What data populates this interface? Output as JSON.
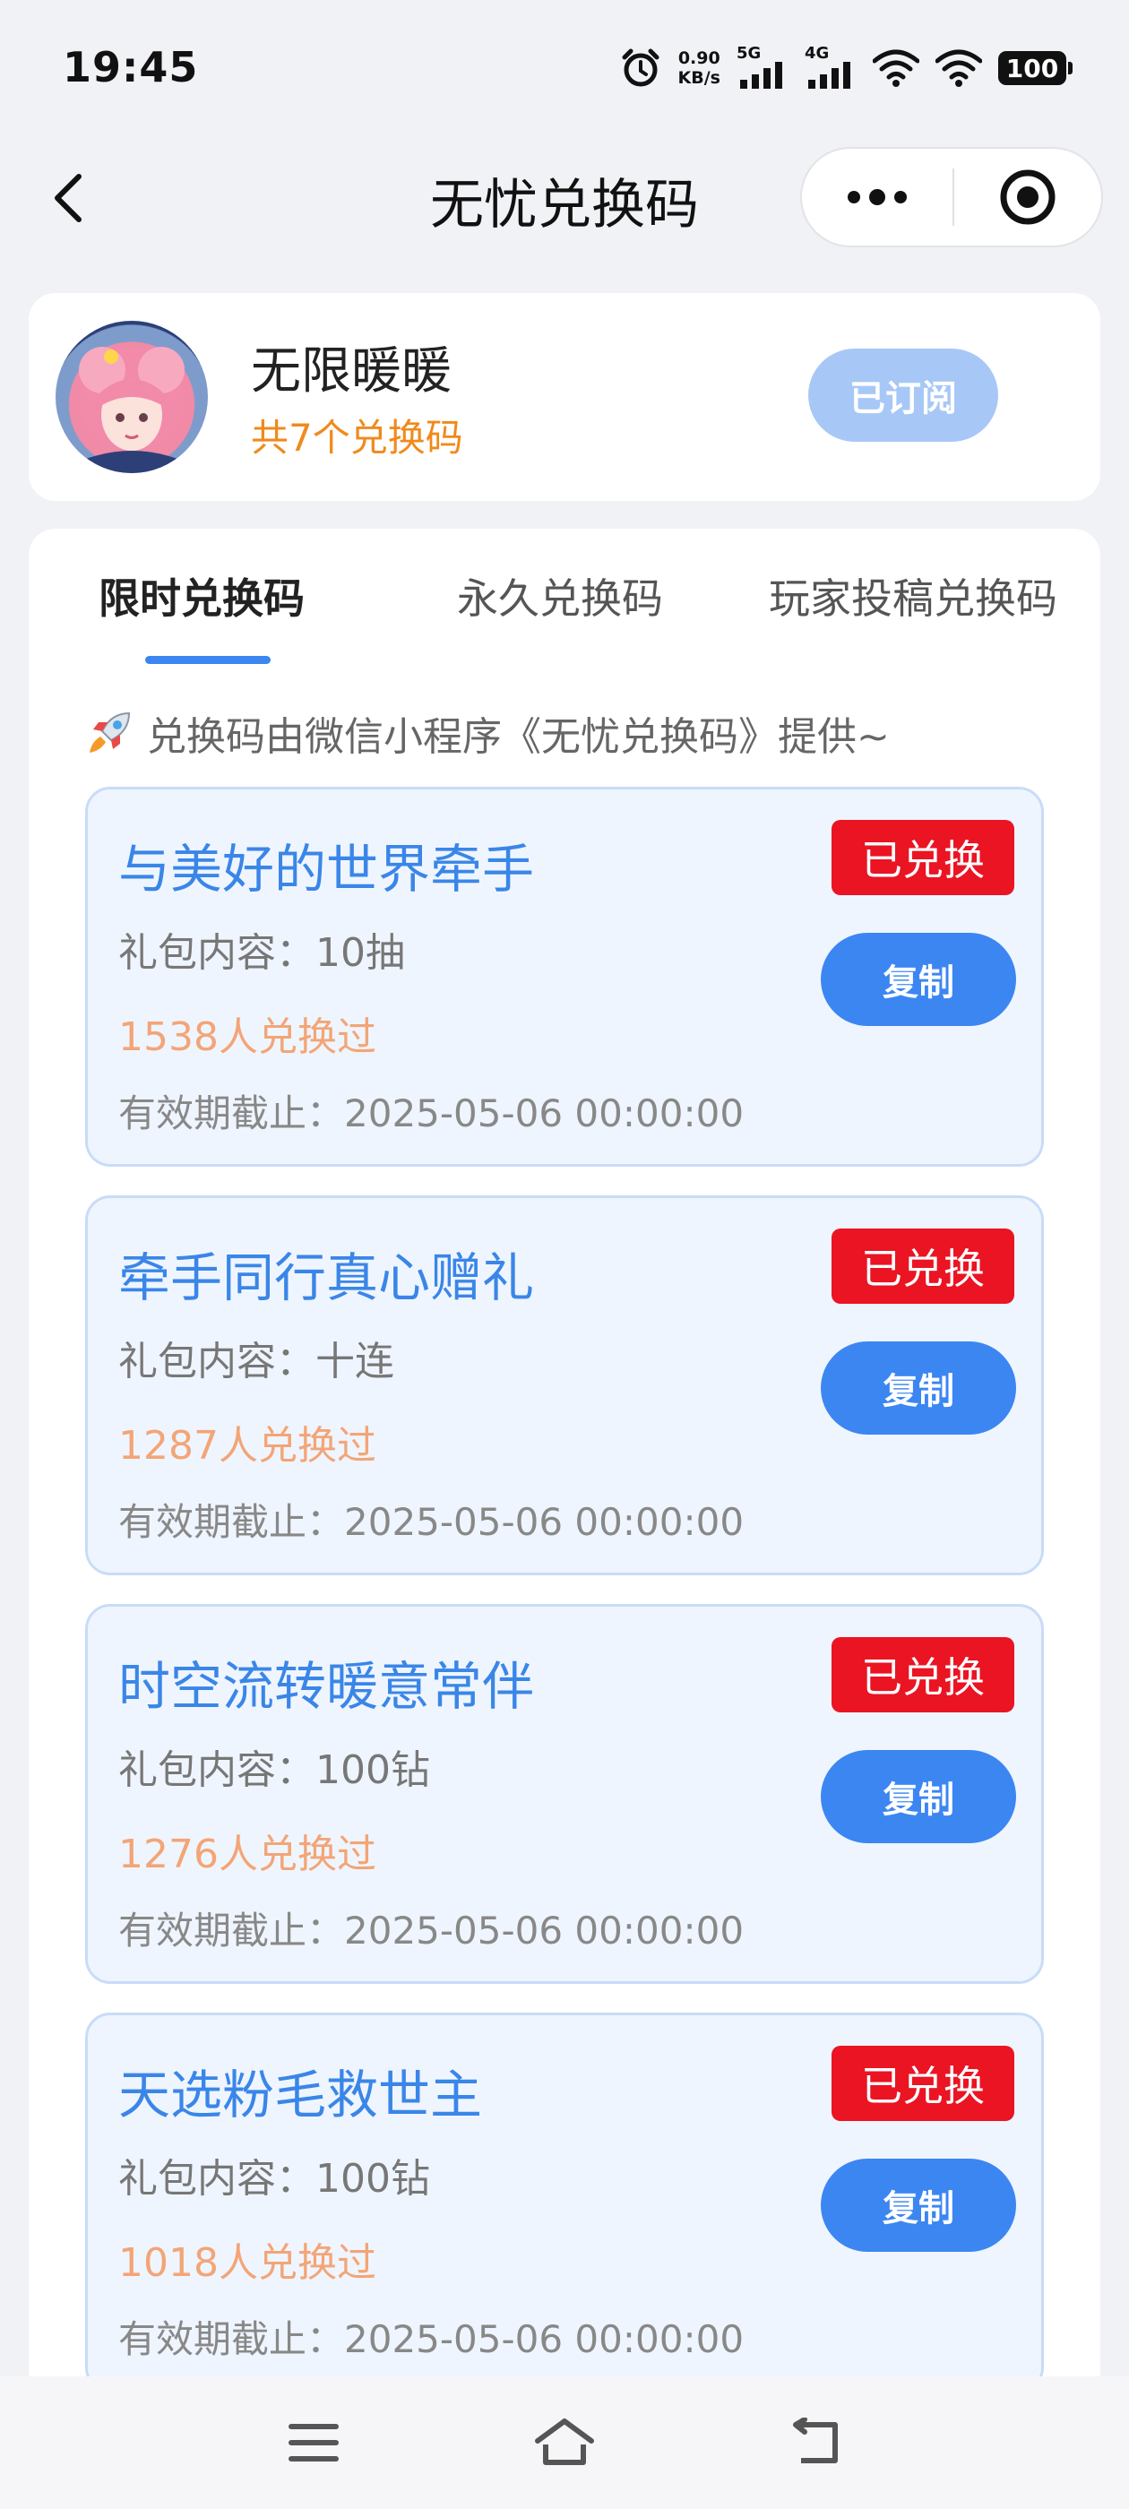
{
  "status_bar": {
    "time": "19:45",
    "speed_value": "0.90",
    "speed_unit": "KB/s",
    "network1": "5G",
    "network2": "4G",
    "battery": "100"
  },
  "nav": {
    "title": "无忧兑换码"
  },
  "profile": {
    "name": "无限暖暖",
    "code_count": "共7个兑换码",
    "subscribe_label": "已订阅"
  },
  "tabs": [
    {
      "label": "限时兑换码",
      "active": true
    },
    {
      "label": "永久兑换码",
      "active": false
    },
    {
      "label": "玩家投稿兑换码",
      "active": false
    }
  ],
  "notice": "兑换码由微信小程序《无忧兑换码》提供~",
  "codes": [
    {
      "title": "与美好的世界牵手",
      "content": "礼包内容：10抽",
      "users": "1538人兑换过",
      "expiry": "有效期截止：2025-05-06 00:00:00",
      "badge": "已兑换",
      "copy": "复制"
    },
    {
      "title": "牵手同行真心赠礼",
      "content": "礼包内容：十连",
      "users": "1287人兑换过",
      "expiry": "有效期截止：2025-05-06 00:00:00",
      "badge": "已兑换",
      "copy": "复制"
    },
    {
      "title": "时空流转暖意常伴",
      "content": "礼包内容：100钻",
      "users": "1276人兑换过",
      "expiry": "有效期截止：2025-05-06 00:00:00",
      "badge": "已兑换",
      "copy": "复制"
    },
    {
      "title": "天选粉毛救世主",
      "content": "礼包内容：100钻",
      "users": "1018人兑换过",
      "expiry": "有效期截止：2025-05-06 00:00:00",
      "badge": "已兑换",
      "copy": "复制"
    }
  ],
  "colors": {
    "accent_blue": "#3c86f2",
    "badge_red": "#ea1423",
    "count_orange": "#f08a1c",
    "users_orange": "#f3a577"
  },
  "icons": [
    "alarm-icon",
    "signal-icon",
    "wifi-icon",
    "back-arrow-icon",
    "more-icon",
    "close-target-icon",
    "rocket-icon",
    "menu-icon",
    "home-icon",
    "return-icon"
  ]
}
